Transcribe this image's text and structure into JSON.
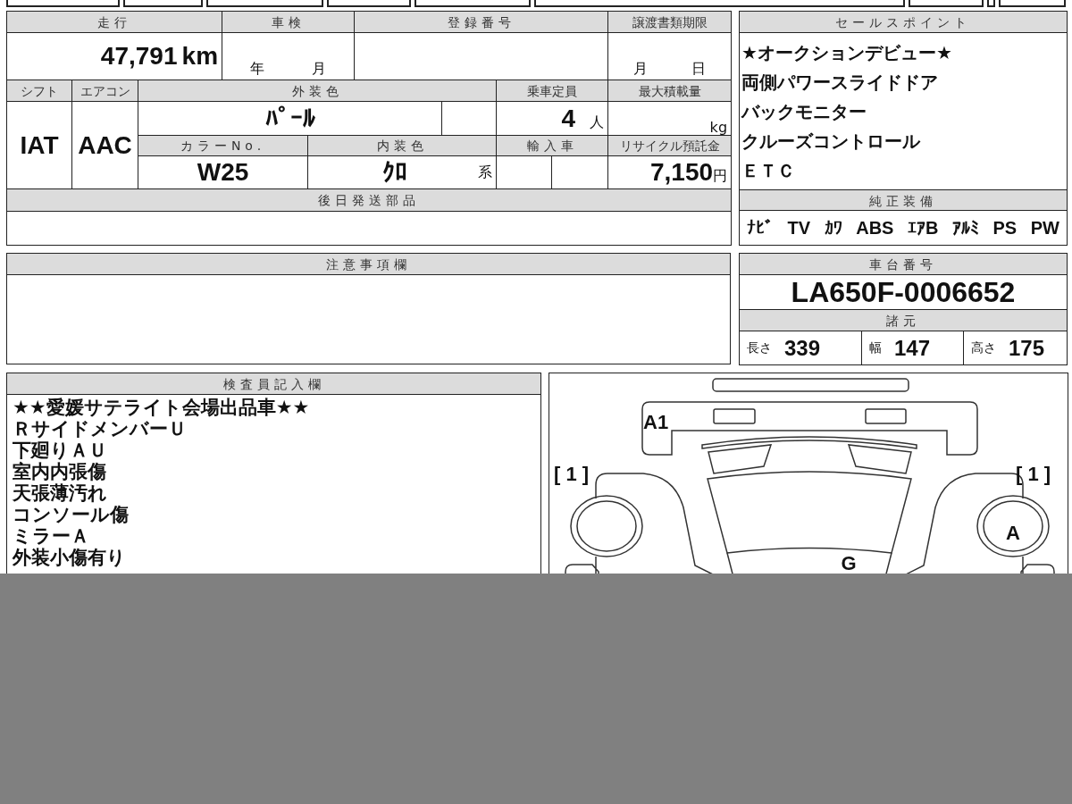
{
  "vehicle_info": {
    "mileage": {
      "label": "走行",
      "value": "47,791",
      "unit": "km"
    },
    "inspection": {
      "label": "車検",
      "year_unit": "年",
      "month_unit": "月"
    },
    "registration_number": {
      "label": "登録番号"
    },
    "transfer_deadline": {
      "label": "譲渡書類期限",
      "month_unit": "月",
      "day_unit": "日"
    },
    "shift": {
      "label": "シフト",
      "value": "IAT"
    },
    "aircon": {
      "label": "エアコン",
      "value": "AAC"
    },
    "exterior_color": {
      "label": "外装色",
      "value": "ﾊﾟｰﾙ"
    },
    "capacity": {
      "label": "乗車定員",
      "value": "4",
      "unit": "人"
    },
    "max_load": {
      "label": "最大積載量",
      "unit": "kg"
    },
    "color_no": {
      "label": "カラーNo.",
      "value": "W25"
    },
    "interior_color": {
      "label": "内装色",
      "value": "ｸﾛ",
      "suffix": "系"
    },
    "import": {
      "label": "輸入車"
    },
    "recycle_deposit": {
      "label": "リサイクル預託金",
      "value": "7,150",
      "unit": "円"
    },
    "later_parts": {
      "label": "後日発送部品"
    }
  },
  "notes": {
    "label": "注意事項欄"
  },
  "sales_points": {
    "label": "セールスポイント",
    "lines": [
      "★オークションデビュー★",
      "両側パワースライドドア",
      "バックモニター",
      "クルーズコントロール",
      "ＥＴＣ"
    ]
  },
  "equipment": {
    "label": "純正装備",
    "items": [
      "ﾅﾋﾞ",
      "TV",
      "ｶﾜ",
      "ABS",
      "ｴｱB",
      "ｱﾙﾐ",
      "PS",
      "PW"
    ]
  },
  "chassis": {
    "label": "車台番号",
    "value": "LA650F-0006652"
  },
  "specs": {
    "label": "諸元",
    "items": [
      {
        "label": "長さ",
        "value": "339"
      },
      {
        "label": "幅",
        "value": "147"
      },
      {
        "label": "高さ",
        "value": "175"
      }
    ]
  },
  "inspector_notes": {
    "label": "検査員記入欄",
    "lines": [
      "★★愛媛サテライト会場出品車★★",
      "ＲサイドメンバーＵ",
      "下廻りＡＵ",
      "室内内張傷",
      "天張薄汚れ",
      "コンソール傷",
      "ミラーＡ",
      "外装小傷有り"
    ]
  },
  "damage_diagram": {
    "marks": [
      {
        "text": "A1"
      },
      {
        "text": "[ 1 ]"
      },
      {
        "text": "[ 1 ]"
      },
      {
        "text": "A"
      },
      {
        "text": "G"
      }
    ]
  }
}
